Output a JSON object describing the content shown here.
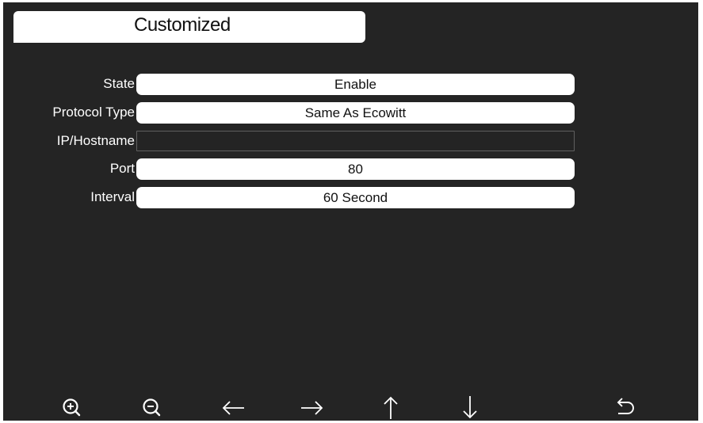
{
  "window": {
    "title": "Customized"
  },
  "form": {
    "rows": [
      {
        "label": "State",
        "value": "Enable"
      },
      {
        "label": "Protocol Type",
        "value": "Same As Ecowitt"
      },
      {
        "label": "IP/Hostname",
        "value": ""
      },
      {
        "label": "Port",
        "value": "80"
      },
      {
        "label": "Interval",
        "value": "60 Second"
      }
    ]
  },
  "toolbar": {
    "icons": [
      "zoom-in-icon",
      "zoom-out-icon",
      "arrow-left-icon",
      "arrow-right-icon",
      "arrow-up-icon",
      "arrow-down-icon",
      "back-icon"
    ]
  },
  "colors": {
    "background": "#242424",
    "field": "#ffffff",
    "text": "#ffffff"
  }
}
